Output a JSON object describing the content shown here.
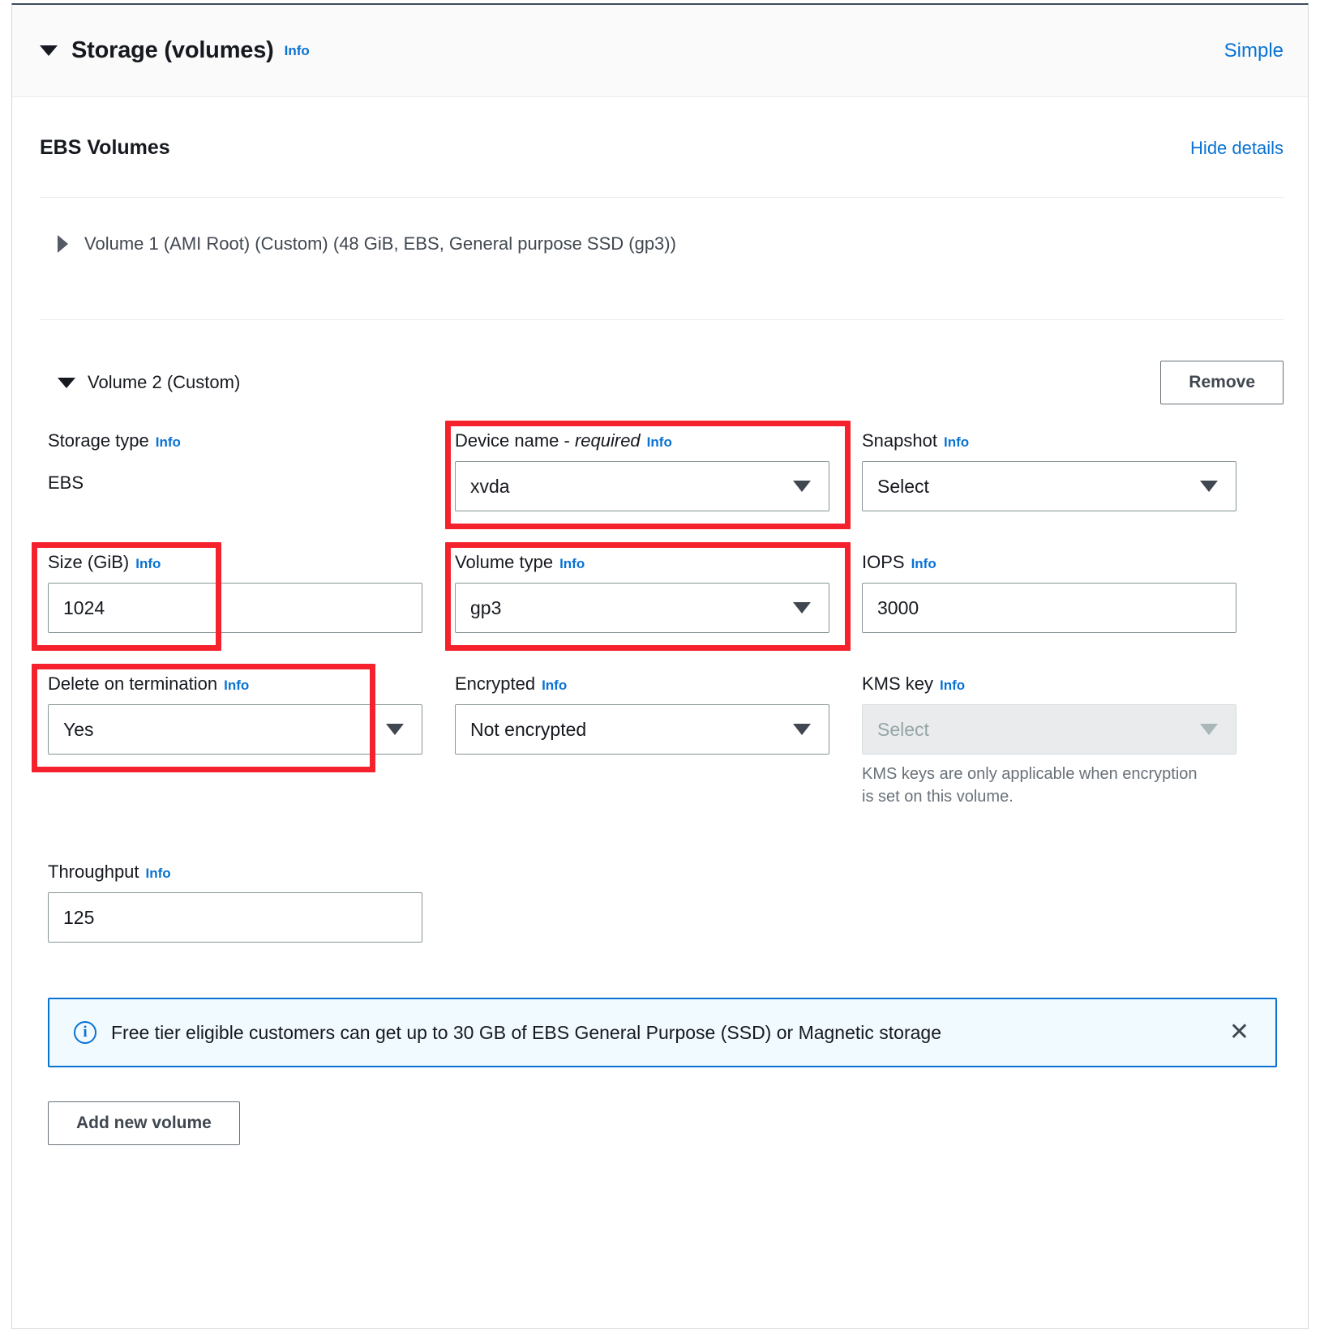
{
  "section": {
    "title": "Storage (volumes)",
    "info_label": "Info",
    "mode_toggle_label": "Simple",
    "collapse_icon": "caret-down-icon"
  },
  "ebs": {
    "heading": "EBS Volumes",
    "hide_details_label": "Hide details"
  },
  "volume1": {
    "expand_icon": "caret-right-icon",
    "summary": "Volume 1 (AMI Root) (Custom) (48 GiB, EBS, General purpose SSD (gp3))"
  },
  "volume2": {
    "collapse_icon": "caret-down-icon",
    "summary": "Volume 2 (Custom)",
    "remove_label": "Remove",
    "fields": {
      "storage_type": {
        "label": "Storage type",
        "info": "Info",
        "value": "EBS"
      },
      "device_name": {
        "label": "Device name - ",
        "label_required": "required",
        "info": "Info",
        "value": "xvda",
        "highlighted": true
      },
      "snapshot": {
        "label": "Snapshot",
        "info": "Info",
        "value": "Select"
      },
      "size_gib": {
        "label": "Size (GiB)",
        "info": "Info",
        "value": "1024",
        "highlighted": true
      },
      "volume_type": {
        "label": "Volume type",
        "info": "Info",
        "value": "gp3",
        "highlighted": true
      },
      "iops": {
        "label": "IOPS",
        "info": "Info",
        "value": "3000"
      },
      "delete_on_termination": {
        "label": "Delete on termination",
        "info": "Info",
        "value": "Yes",
        "highlighted": true
      },
      "encrypted": {
        "label": "Encrypted",
        "info": "Info",
        "value": "Not encrypted"
      },
      "kms_key": {
        "label": "KMS key",
        "info": "Info",
        "value": "Select",
        "disabled": true,
        "hint": "KMS keys are only applicable when encryption is set on this volume."
      },
      "throughput": {
        "label": "Throughput",
        "info": "Info",
        "value": "125"
      }
    }
  },
  "alert": {
    "icon": "info-circle-icon",
    "text": "Free tier eligible customers can get up to 30 GB of EBS General Purpose (SSD) or Magnetic storage",
    "close_icon": "close-icon",
    "close_glyph": "✕"
  },
  "footer": {
    "add_volume_label": "Add new volume"
  },
  "colors": {
    "link": "#0972d3",
    "highlight": "#f5222d",
    "alert_bg": "#f1faff",
    "header_bg": "#fafafa",
    "border": "#d5dbdb"
  }
}
